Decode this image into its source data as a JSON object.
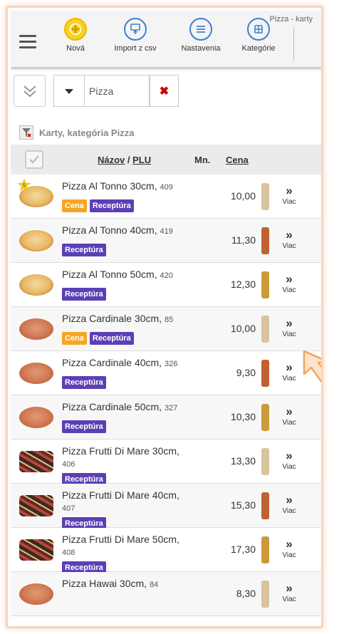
{
  "toolbar": {
    "title": "Pizza - karty",
    "buttons": [
      {
        "label": "Nová",
        "icon": "plus-icon",
        "color": "#f5c400"
      },
      {
        "label": "Import z csv",
        "icon": "import-icon",
        "color": "#3d7fd0"
      },
      {
        "label": "Nastavenia",
        "icon": "list-icon",
        "color": "#3d7fd0"
      },
      {
        "label": "Kategórie",
        "icon": "categories-icon",
        "color": "#3d7fd0"
      }
    ]
  },
  "filter": {
    "value": "Pizza"
  },
  "category_line": "Karty, kategória Pizza",
  "table": {
    "header": {
      "name": "Názov",
      "separator": " / ",
      "plu": "PLU",
      "qty": "Mn.",
      "price": "Cena"
    },
    "more_label": "Viac",
    "more_arrow": "»",
    "rows": [
      {
        "name": "Pizza Al Tonno 30cm,",
        "plu": "409",
        "price": "10,00",
        "badges": [
          "Cena",
          "Receptúra"
        ],
        "bar": "#d9c39c",
        "thumb": "plain",
        "star": "5"
      },
      {
        "name": "Pizza Al Tonno 40cm,",
        "plu": "419",
        "price": "11,30",
        "badges": [
          "Receptúra"
        ],
        "bar": "#c0622f",
        "thumb": "plain"
      },
      {
        "name": "Pizza Al Tonno 50cm,",
        "plu": "420",
        "price": "12,30",
        "badges": [
          "Receptúra"
        ],
        "bar": "#cc9a3a",
        "thumb": "plain"
      },
      {
        "name": "Pizza Cardinale 30cm,",
        "plu": "85",
        "price": "10,00",
        "badges": [
          "Cena",
          "Receptúra"
        ],
        "bar": "#d9c39c",
        "thumb": "cardinale"
      },
      {
        "name": "Pizza Cardinale 40cm,",
        "plu": "326",
        "price": "9,30",
        "badges": [
          "Receptúra"
        ],
        "bar": "#c0622f",
        "thumb": "cardinale"
      },
      {
        "name": "Pizza Cardinale 50cm,",
        "plu": "327",
        "price": "10,30",
        "badges": [
          "Receptúra"
        ],
        "bar": "#cc9a3a",
        "thumb": "cardinale"
      },
      {
        "name": "Pizza Frutti Di Mare 30cm,",
        "plu": "406",
        "price": "13,30",
        "badges": [
          "Receptúra"
        ],
        "bar": "#d9c39c",
        "thumb": "frutti",
        "tall": true
      },
      {
        "name": "Pizza Frutti Di Mare 40cm,",
        "plu": "407",
        "price": "15,30",
        "badges": [
          "Receptúra"
        ],
        "bar": "#c0622f",
        "thumb": "frutti",
        "tall": true
      },
      {
        "name": "Pizza Frutti Di Mare 50cm,",
        "plu": "408",
        "price": "17,30",
        "badges": [
          "Receptúra"
        ],
        "bar": "#cc9a3a",
        "thumb": "frutti",
        "tall": true
      },
      {
        "name": "Pizza Hawai 30cm,",
        "plu": "84",
        "price": "8,30",
        "badges": [],
        "bar": "#d9c39c",
        "thumb": "cardinale"
      }
    ]
  }
}
